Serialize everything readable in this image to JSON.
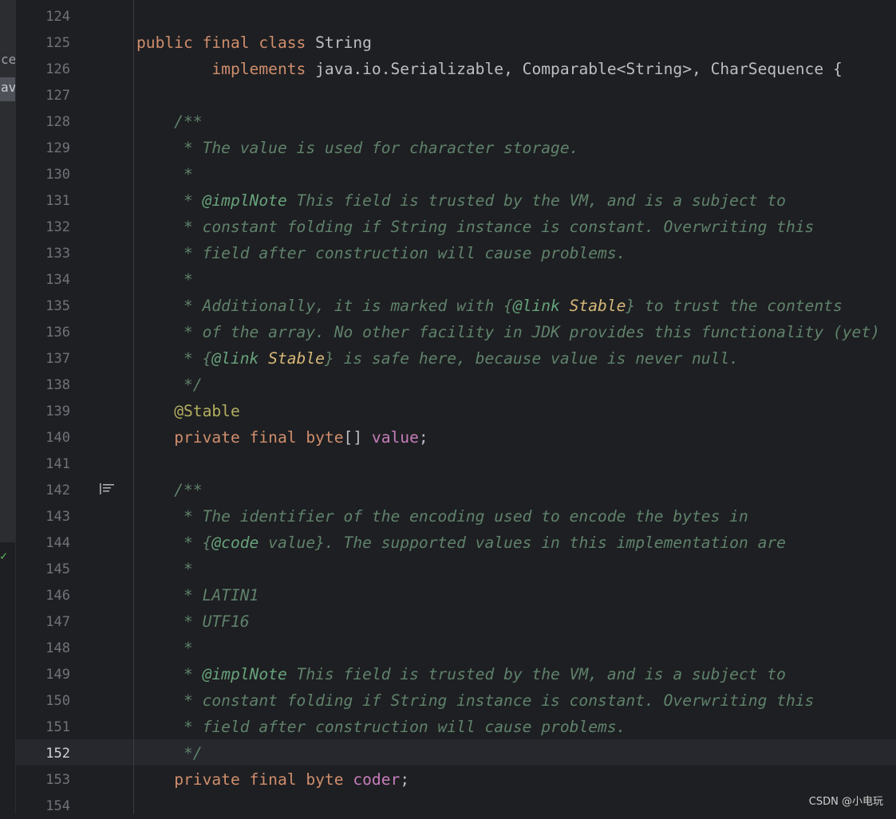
{
  "sidebar": {
    "fragment_1": "ce",
    "fragment_2": "av",
    "check_glyph": "✓"
  },
  "editor": {
    "current_line": 152,
    "lines": [
      {
        "n": "124",
        "tokens": []
      },
      {
        "n": "125",
        "tokens": [
          [
            "kw",
            "public"
          ],
          [
            "t",
            " "
          ],
          [
            "kw",
            "final"
          ],
          [
            "t",
            " "
          ],
          [
            "kw",
            "class"
          ],
          [
            "t",
            " String"
          ]
        ]
      },
      {
        "n": "126",
        "tokens": [
          [
            "t",
            "        "
          ],
          [
            "kw",
            "implements"
          ],
          [
            "t",
            " java.io.Serializable, Comparable<String>, CharSequence {"
          ]
        ]
      },
      {
        "n": "127",
        "tokens": []
      },
      {
        "n": "128",
        "tokens": [
          [
            "doc",
            "    /**"
          ]
        ]
      },
      {
        "n": "129",
        "tokens": [
          [
            "doc",
            "     * The value is used for character storage."
          ]
        ]
      },
      {
        "n": "130",
        "tokens": [
          [
            "doc",
            "     *"
          ]
        ]
      },
      {
        "n": "131",
        "tokens": [
          [
            "doc",
            "     * "
          ],
          [
            "dtag",
            "@implNote"
          ],
          [
            "doc",
            " This field is trusted by the VM, and is a subject to"
          ]
        ]
      },
      {
        "n": "132",
        "tokens": [
          [
            "doc",
            "     * constant folding if String instance is constant. Overwriting this"
          ]
        ]
      },
      {
        "n": "133",
        "tokens": [
          [
            "doc",
            "     * field after construction will cause problems."
          ]
        ]
      },
      {
        "n": "134",
        "tokens": [
          [
            "doc",
            "     *"
          ]
        ]
      },
      {
        "n": "135",
        "tokens": [
          [
            "doc",
            "     * Additionally, it is marked with {"
          ],
          [
            "dtag",
            "@link"
          ],
          [
            "doc",
            " "
          ],
          [
            "dref",
            "Stable"
          ],
          [
            "doc",
            "} to trust the contents"
          ]
        ]
      },
      {
        "n": "136",
        "tokens": [
          [
            "doc",
            "     * of the array. No other facility in JDK provides this functionality (yet)"
          ]
        ]
      },
      {
        "n": "137",
        "tokens": [
          [
            "doc",
            "     * {"
          ],
          [
            "dtag",
            "@link"
          ],
          [
            "doc",
            " "
          ],
          [
            "dref",
            "Stable"
          ],
          [
            "doc",
            "} is safe here, because value is never null."
          ]
        ]
      },
      {
        "n": "138",
        "tokens": [
          [
            "doc",
            "     */"
          ]
        ]
      },
      {
        "n": "139",
        "tokens": [
          [
            "t",
            "    "
          ],
          [
            "ann",
            "@Stable"
          ]
        ]
      },
      {
        "n": "140",
        "tokens": [
          [
            "t",
            "    "
          ],
          [
            "kw",
            "private"
          ],
          [
            "t",
            " "
          ],
          [
            "kw",
            "final"
          ],
          [
            "t",
            " "
          ],
          [
            "kw",
            "byte"
          ],
          [
            "t",
            "[] "
          ],
          [
            "fld",
            "value"
          ],
          [
            "t",
            ";"
          ]
        ]
      },
      {
        "n": "141",
        "tokens": []
      },
      {
        "n": "142",
        "tokens": [
          [
            "doc",
            "    /**"
          ]
        ]
      },
      {
        "n": "143",
        "tokens": [
          [
            "doc",
            "     * The identifier of the encoding used to encode the bytes in"
          ]
        ]
      },
      {
        "n": "144",
        "tokens": [
          [
            "doc",
            "     * {"
          ],
          [
            "dtag",
            "@code"
          ],
          [
            "doc",
            " value}. The supported values in this implementation are"
          ]
        ]
      },
      {
        "n": "145",
        "tokens": [
          [
            "doc",
            "     *"
          ]
        ]
      },
      {
        "n": "146",
        "tokens": [
          [
            "doc",
            "     * LATIN1"
          ]
        ]
      },
      {
        "n": "147",
        "tokens": [
          [
            "doc",
            "     * UTF16"
          ]
        ]
      },
      {
        "n": "148",
        "tokens": [
          [
            "doc",
            "     *"
          ]
        ]
      },
      {
        "n": "149",
        "tokens": [
          [
            "doc",
            "     * "
          ],
          [
            "dtag",
            "@implNote"
          ],
          [
            "doc",
            " This field is trusted by the VM, and is a subject to"
          ]
        ]
      },
      {
        "n": "150",
        "tokens": [
          [
            "doc",
            "     * constant folding if String instance is constant. Overwriting this"
          ]
        ]
      },
      {
        "n": "151",
        "tokens": [
          [
            "doc",
            "     * field after construction will cause problems."
          ]
        ]
      },
      {
        "n": "152",
        "tokens": [
          [
            "doc",
            "     */"
          ]
        ]
      },
      {
        "n": "153",
        "tokens": [
          [
            "t",
            "    "
          ],
          [
            "kw",
            "private"
          ],
          [
            "t",
            " "
          ],
          [
            "kw",
            "final"
          ],
          [
            "t",
            " "
          ],
          [
            "kw",
            "byte"
          ],
          [
            "t",
            " "
          ],
          [
            "fld",
            "coder"
          ],
          [
            "t",
            ";"
          ]
        ]
      },
      {
        "n": "154",
        "tokens": []
      }
    ]
  },
  "gutter_icon": "render-documentation-icon",
  "watermark": "CSDN @小电玩"
}
